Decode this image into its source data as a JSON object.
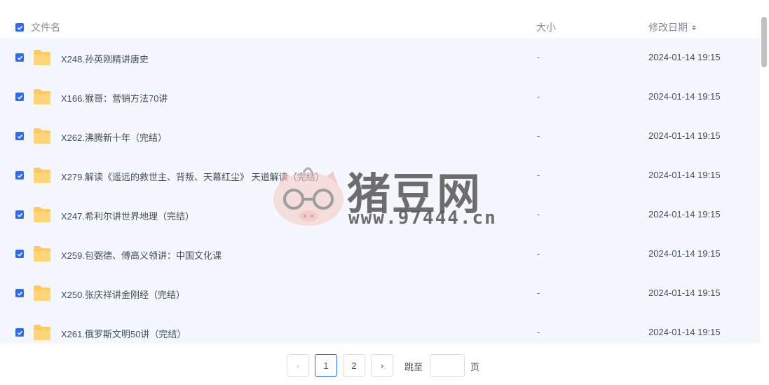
{
  "header": {
    "name_label": "文件名",
    "size_label": "大小",
    "date_label": "修改日期"
  },
  "rows": [
    {
      "name": "X248.孙英刚精讲唐史",
      "size": "-",
      "date": "2024-01-14 19:15"
    },
    {
      "name": "X166.猴哥：营销方法70讲",
      "size": "-",
      "date": "2024-01-14 19:15"
    },
    {
      "name": "X262.沸腾新十年（完结）",
      "size": "-",
      "date": "2024-01-14 19:15"
    },
    {
      "name": "X279.解读《遥远的救世主、背叛、天幕红尘》 天道解读（完结）",
      "size": "-",
      "date": "2024-01-14 19:15"
    },
    {
      "name": "X247.希利尔讲世界地理（完结）",
      "size": "-",
      "date": "2024-01-14 19:15"
    },
    {
      "name": "X259.包弼德、傅高义领讲：中国文化课",
      "size": "-",
      "date": "2024-01-14 19:15"
    },
    {
      "name": "X250.张庆祥讲金刚经（完结）",
      "size": "-",
      "date": "2024-01-14 19:15"
    },
    {
      "name": "X261.俄罗斯文明50讲（完结）",
      "size": "-",
      "date": "2024-01-14 19:15"
    }
  ],
  "watermark": {
    "title": "猪豆网",
    "url": "www.97444.cn"
  },
  "pager": {
    "prev_symbol": "‹",
    "next_symbol": "›",
    "pages": [
      "1",
      "2"
    ],
    "current_page": "1",
    "jump_label": "跳至",
    "page_label": "页",
    "jump_value": ""
  },
  "colors": {
    "accent": "#2e6bf0",
    "folder": "#ffc95c",
    "list_bg": "#f5f7fe"
  }
}
